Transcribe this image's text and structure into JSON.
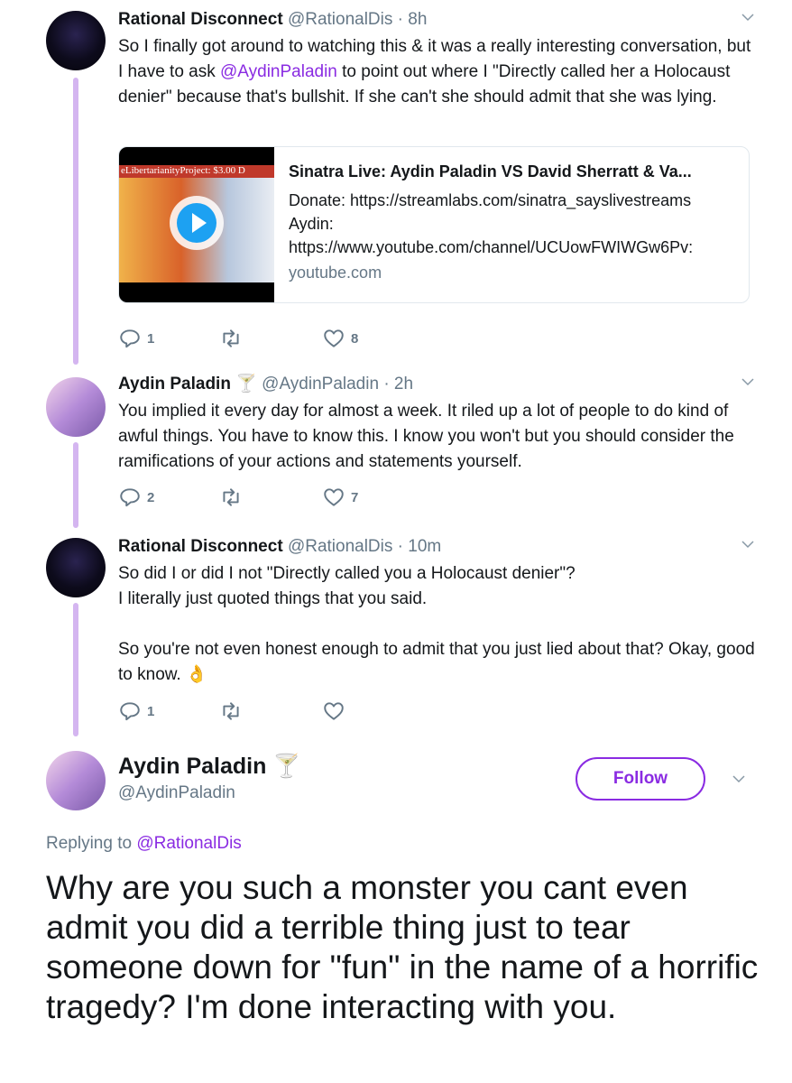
{
  "tweets": [
    {
      "name": "Rational Disconnect",
      "handle": "@RationalDis",
      "time": "· 8h",
      "body_pre": "So I finally got around to watching this & it was a really interesting conversation, but I have to ask ",
      "body_mention": "@AydinPaladin",
      "body_post": " to point out where I \"Directly called her a Holocaust denier\" because that's bullshit. If she can't she should admit that she was lying.",
      "replies": "1",
      "likes": "8"
    },
    {
      "name": "Aydin Paladin",
      "handle": "@AydinPaladin",
      "time": "· 2h",
      "body": "You implied it every day for almost a week. It riled up a lot of people to do kind of awful things. You have to know this. I know you won't but you should consider the ramifications of your actions and statements yourself.",
      "replies": "2",
      "likes": "7"
    },
    {
      "name": "Rational Disconnect",
      "handle": "@RationalDis",
      "time": "· 10m",
      "line1": "So did I or did I not \"Directly called you a Holocaust denier\"?",
      "line2": "I literally just quoted things that you said.",
      "line3": "So you're not even honest enough to admit that you just lied about that? Okay, good to know.",
      "emoji": "👌",
      "replies": "1"
    }
  ],
  "card": {
    "title": "Sinatra Live: Aydin Paladin VS David Sherratt & Va...",
    "desc_line1": "Donate: https://streamlabs.com/sinatra_sayslivestreams",
    "desc_line2": "Aydin:",
    "desc_line3": "https://www.youtube.com/channel/UCUowFWIWGw6Pv:",
    "domain": "youtube.com",
    "thumb_text": "eLibertarianityProject: $3.00   D"
  },
  "main": {
    "name": "Aydin Paladin",
    "handle": "@AydinPaladin",
    "follow_label": "Follow",
    "replying_prefix": "Replying to ",
    "replying_mention": "@RationalDis",
    "text": "Why are you such a monster you cant even admit you did a terrible thing just to tear someone down for \"fun\" in the name of a horrific tragedy? I'm done interacting with you."
  },
  "icons": {
    "cocktail": "🍸",
    "chevron": "chevron-down-icon",
    "reply": "reply-icon",
    "retweet": "retweet-icon",
    "like": "heart-icon"
  },
  "colors": {
    "accent": "#8a2be2",
    "thread_line": "#d4b5f0",
    "secondary_text": "#657786"
  }
}
